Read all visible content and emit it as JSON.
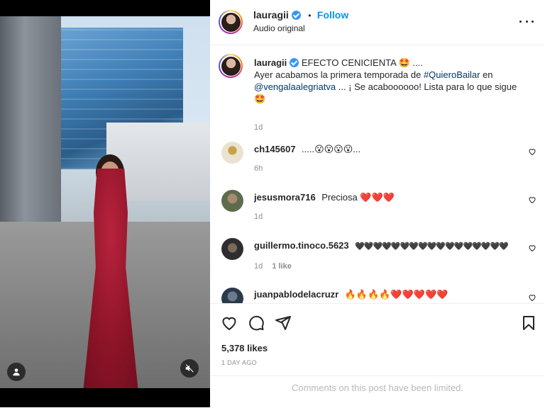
{
  "post": {
    "username": "lauragii",
    "follow_label": "Follow",
    "audio_label": "Audio original",
    "dot": "•"
  },
  "caption": {
    "username": "lauragii",
    "line1": "EFECTO CENICIENTA 🤩 ....",
    "line2_prefix": "Ayer acabamos la primera temporada de ",
    "hashtag": "#QuieroBailar",
    "line2_suffix": " en",
    "mention": "@vengalaalegriatva",
    "line3_suffix": " ... ¡ Se acaboooooo! Lista para lo que sigue",
    "line4": "🤩",
    "time": "1d"
  },
  "comments": [
    {
      "user": "ch145607",
      "text": ".....😮😮😮😮...",
      "time": "6h",
      "likes": ""
    },
    {
      "user": "jesusmora716",
      "text": "Preciosa ❤️❤️❤️",
      "time": "1d",
      "likes": ""
    },
    {
      "user": "guillermo.tinoco.5623",
      "text": "🖤🖤🖤🖤🖤🖤🖤🖤🖤🖤🖤🖤🖤🖤🖤🖤🖤",
      "time": "1d",
      "likes": "1 like"
    },
    {
      "user": "juanpablodelacruzr",
      "text": "🔥🔥🔥🔥❤️❤️❤️❤️❤️",
      "time": "",
      "likes": ""
    }
  ],
  "stats": {
    "likes": "5,378 likes",
    "posted": "1 DAY AGO"
  },
  "footer": {
    "limited": "Comments on this post have been limited."
  },
  "icons": {
    "more": "more-options-icon",
    "heart": "heart-icon",
    "comment": "comment-icon",
    "share": "share-icon",
    "save": "bookmark-icon",
    "mute": "muted-speaker-icon",
    "user": "user-tag-icon"
  },
  "colors": {
    "accent": "#0095f6",
    "verified": "#3897f0",
    "muted": "#8e8e8e"
  }
}
